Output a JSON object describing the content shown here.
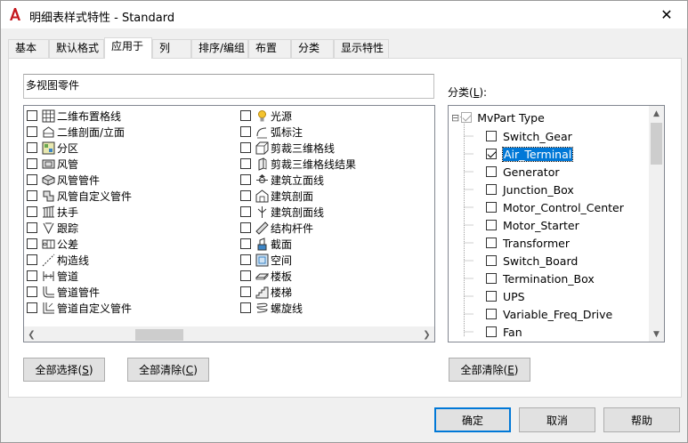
{
  "window": {
    "title": "明细表样式特性 - Standard",
    "close_glyph": "✕"
  },
  "tabs": [
    {
      "label": "基本",
      "active": false
    },
    {
      "label": "默认格式",
      "active": false
    },
    {
      "label": "应用于",
      "active": true
    },
    {
      "label": "列",
      "active": false
    },
    {
      "label": "排序/编组",
      "active": false
    },
    {
      "label": "布置",
      "active": false
    },
    {
      "label": "分类",
      "active": false
    },
    {
      "label": "显示特性",
      "active": false
    }
  ],
  "apply_to": {
    "name_value": "多视图零件",
    "left_items": [
      {
        "label": "二维布置格线",
        "icon": "grid-layout-icon",
        "checked": false
      },
      {
        "label": "二维剖面/立面",
        "icon": "section-elevation-icon",
        "checked": false
      },
      {
        "label": "分区",
        "icon": "zone-icon",
        "checked": false
      },
      {
        "label": "风管",
        "icon": "duct-icon",
        "checked": false
      },
      {
        "label": "风管管件",
        "icon": "duct-fitting-icon",
        "checked": false
      },
      {
        "label": "风管自定义管件",
        "icon": "duct-custom-fitting-icon",
        "checked": false
      },
      {
        "label": "扶手",
        "icon": "railing-icon",
        "checked": false
      },
      {
        "label": "跟踪",
        "icon": "trace-icon",
        "checked": false
      },
      {
        "label": "公差",
        "icon": "tolerance-icon",
        "checked": false
      },
      {
        "label": "构造线",
        "icon": "construction-line-icon",
        "checked": false
      },
      {
        "label": "管道",
        "icon": "pipe-icon",
        "checked": false
      },
      {
        "label": "管道管件",
        "icon": "pipe-fitting-icon",
        "checked": false
      },
      {
        "label": "管道自定义管件",
        "icon": "pipe-custom-fitting-icon",
        "checked": false
      }
    ],
    "right_items": [
      {
        "label": "光源",
        "icon": "light-source-icon",
        "checked": false
      },
      {
        "label": "弧标注",
        "icon": "arc-dimension-icon",
        "checked": false
      },
      {
        "label": "剪裁三维格线",
        "icon": "clip-3d-grid-icon",
        "checked": false
      },
      {
        "label": "剪裁三维格线结果",
        "icon": "clip-3d-grid-result-icon",
        "checked": false
      },
      {
        "label": "建筑立面线",
        "icon": "building-elevation-line-icon",
        "checked": false
      },
      {
        "label": "建筑剖面",
        "icon": "building-section-icon",
        "checked": false
      },
      {
        "label": "建筑剖面线",
        "icon": "building-section-line-icon",
        "checked": false
      },
      {
        "label": "结构杆件",
        "icon": "structural-member-icon",
        "checked": false
      },
      {
        "label": "截面",
        "icon": "section-icon",
        "checked": false
      },
      {
        "label": "空间",
        "icon": "space-icon",
        "checked": false
      },
      {
        "label": "楼板",
        "icon": "slab-icon",
        "checked": false
      },
      {
        "label": "楼梯",
        "icon": "stair-icon",
        "checked": false
      },
      {
        "label": "螺旋线",
        "icon": "helix-icon",
        "checked": false
      }
    ],
    "select_all_label": "全部选择(",
    "select_all_key": "S",
    "clear_all_label": "全部清除(",
    "clear_all_key": "C",
    "close_paren": ")"
  },
  "classification": {
    "label_prefix": "分类(",
    "label_key": "L",
    "label_suffix": "):",
    "root": {
      "label": "MvPart Type",
      "checked": true
    },
    "items": [
      {
        "label": "Switch_Gear",
        "checked": false,
        "selected": false
      },
      {
        "label": "Air_Terminal",
        "checked": true,
        "selected": true
      },
      {
        "label": "Generator",
        "checked": false,
        "selected": false
      },
      {
        "label": "Junction_Box",
        "checked": false,
        "selected": false
      },
      {
        "label": "Motor_Control_Center",
        "checked": false,
        "selected": false
      },
      {
        "label": "Motor_Starter",
        "checked": false,
        "selected": false
      },
      {
        "label": "Transformer",
        "checked": false,
        "selected": false
      },
      {
        "label": "Switch_Board",
        "checked": false,
        "selected": false
      },
      {
        "label": "Termination_Box",
        "checked": false,
        "selected": false
      },
      {
        "label": "UPS",
        "checked": false,
        "selected": false
      },
      {
        "label": "Variable_Freq_Drive",
        "checked": false,
        "selected": false
      },
      {
        "label": "Fan",
        "checked": false,
        "selected": false
      }
    ],
    "clear_all_label": "全部清除(",
    "clear_all_key": "E",
    "close_paren": ")",
    "collapse_glyph": "⊟"
  },
  "footer": {
    "ok_label": "确定",
    "cancel_label": "取消",
    "help_label": "帮助"
  },
  "colors": {
    "accent": "#0078d7",
    "app_icon": "#c4161c"
  }
}
